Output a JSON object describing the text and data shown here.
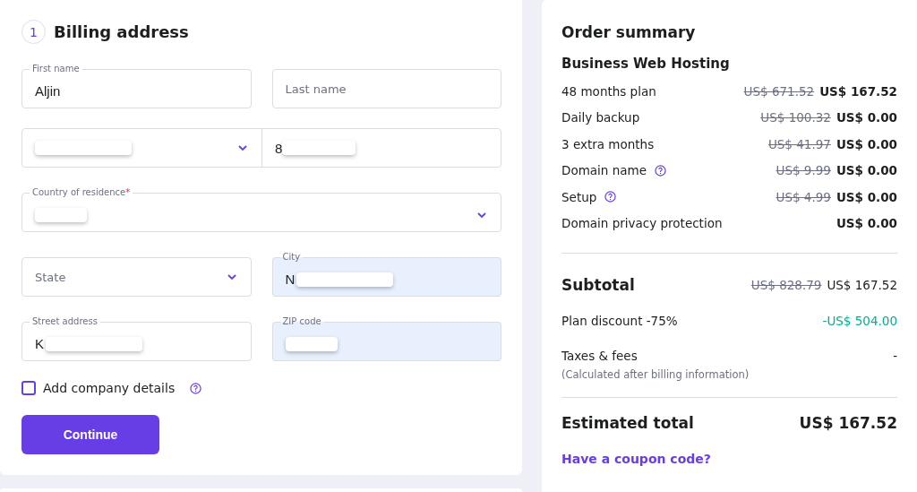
{
  "billing": {
    "step": "1",
    "title": "Billing address",
    "rows": [
      {
        "fields": [
          {
            "kind": "text",
            "label": "First name",
            "value": "Aljin",
            "autofilled": false
          },
          {
            "kind": "text",
            "placeholder": "Last name",
            "autofilled": false
          }
        ]
      },
      {
        "fields": [
          {
            "kind": "phone",
            "value": "8",
            "redacted": true
          }
        ]
      },
      {
        "fields": [
          {
            "kind": "select",
            "label": "Country of residence",
            "required_mark": "*",
            "redacted": true,
            "autofilled": false
          }
        ]
      },
      {
        "fields": [
          {
            "kind": "select",
            "placeholder": "State",
            "autofilled": false
          },
          {
            "kind": "text",
            "label": "City",
            "value": "N",
            "redacted": true,
            "autofilled": true
          }
        ]
      },
      {
        "fields": [
          {
            "kind": "text",
            "label": "Street address",
            "value": "K",
            "redacted": true,
            "autofilled": false
          },
          {
            "kind": "text",
            "label": "ZIP code",
            "redacted": true,
            "autofilled": true
          }
        ]
      }
    ],
    "company": {
      "label": "Add company details",
      "checked": false
    },
    "continue_button": "Continue"
  },
  "summary": {
    "title": "Order summary",
    "product": "Business Web Hosting",
    "items": [
      {
        "label": "48 months plan",
        "old_price": "US$ 671.52",
        "price": "US$ 167.52",
        "help": false
      },
      {
        "label": "Daily backup",
        "old_price": "US$ 100.32",
        "price": "US$ 0.00",
        "help": false
      },
      {
        "label": "3 extra months",
        "old_price": "US$ 41.97",
        "price": "US$ 0.00",
        "help": false
      },
      {
        "label": "Domain name",
        "old_price": "US$ 9.99",
        "price": "US$ 0.00",
        "help": true
      },
      {
        "label": "Setup",
        "old_price": "US$ 4.99",
        "price": "US$ 0.00",
        "help": true
      },
      {
        "label": "Domain privacy protection",
        "price": "US$ 0.00",
        "help": false
      }
    ],
    "subtotal": {
      "label": "Subtotal",
      "old_price": "US$ 828.79",
      "price": "US$ 167.52"
    },
    "discount": {
      "label": "Plan discount -75%",
      "value": "-US$ 504.00"
    },
    "taxes": {
      "label": "Taxes & fees",
      "note": "(Calculated after billing information)",
      "value": "-"
    },
    "total": {
      "label": "Estimated total",
      "value": "US$ 167.52"
    },
    "coupon_link": "Have a coupon code?"
  }
}
